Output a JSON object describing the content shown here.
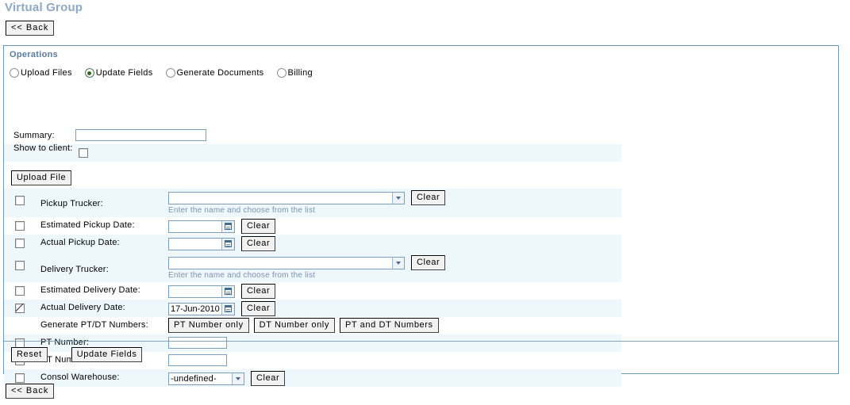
{
  "page": {
    "title": "Virtual Group",
    "back_label": "<< Back"
  },
  "panel": {
    "title": "Operations",
    "radios": [
      {
        "label": "Upload Files",
        "selected": false
      },
      {
        "label": "Update Fields",
        "selected": true
      },
      {
        "label": "Generate Documents",
        "selected": false
      },
      {
        "label": "Billing",
        "selected": false
      }
    ],
    "summary": {
      "label": "Summary:",
      "value": "",
      "placeholder": ""
    },
    "show_to_client": {
      "label": "Show to client:",
      "checked": false
    },
    "upload_file_label": "Upload File",
    "clear_label": "Clear",
    "combo_hint": "Enter the name and choose from the list",
    "rows": {
      "pickup_trucker": {
        "label": "Pickup Trucker:",
        "checked": false,
        "value": ""
      },
      "estimated_pickup_date": {
        "label": "Estimated Pickup Date:",
        "checked": false,
        "value": ""
      },
      "actual_pickup_date": {
        "label": "Actual Pickup Date:",
        "checked": false,
        "value": ""
      },
      "delivery_trucker": {
        "label": "Delivery Trucker:",
        "checked": false,
        "value": ""
      },
      "estimated_delivery_date": {
        "label": "Estimated Delivery Date:",
        "checked": false,
        "value": ""
      },
      "actual_delivery_date": {
        "label": "Actual Delivery Date:",
        "checked": true,
        "value": "17-Jun-2010"
      },
      "generate_numbers": {
        "label": "Generate PT/DT Numbers:",
        "buttons": [
          "PT Number only",
          "DT Number only",
          "PT and DT Numbers"
        ]
      },
      "pt_number": {
        "label": "PT Number:",
        "checked": false,
        "value": ""
      },
      "dt_number": {
        "label": "DT Number:",
        "checked": false,
        "value": ""
      },
      "consol_warehouse": {
        "label": "Consol Warehouse:",
        "checked": false,
        "value": "-undefined-"
      }
    },
    "actions": {
      "reset_label": "Reset",
      "update_label": "Update Fields"
    }
  },
  "colors": {
    "page_title": "#8fa8c4",
    "panel_title": "#5b7c9d",
    "panel_border": "#6f9ab0",
    "row_alt": "#eef7fb",
    "hint": "#7b94ae",
    "radio_dot": "#33691e"
  }
}
